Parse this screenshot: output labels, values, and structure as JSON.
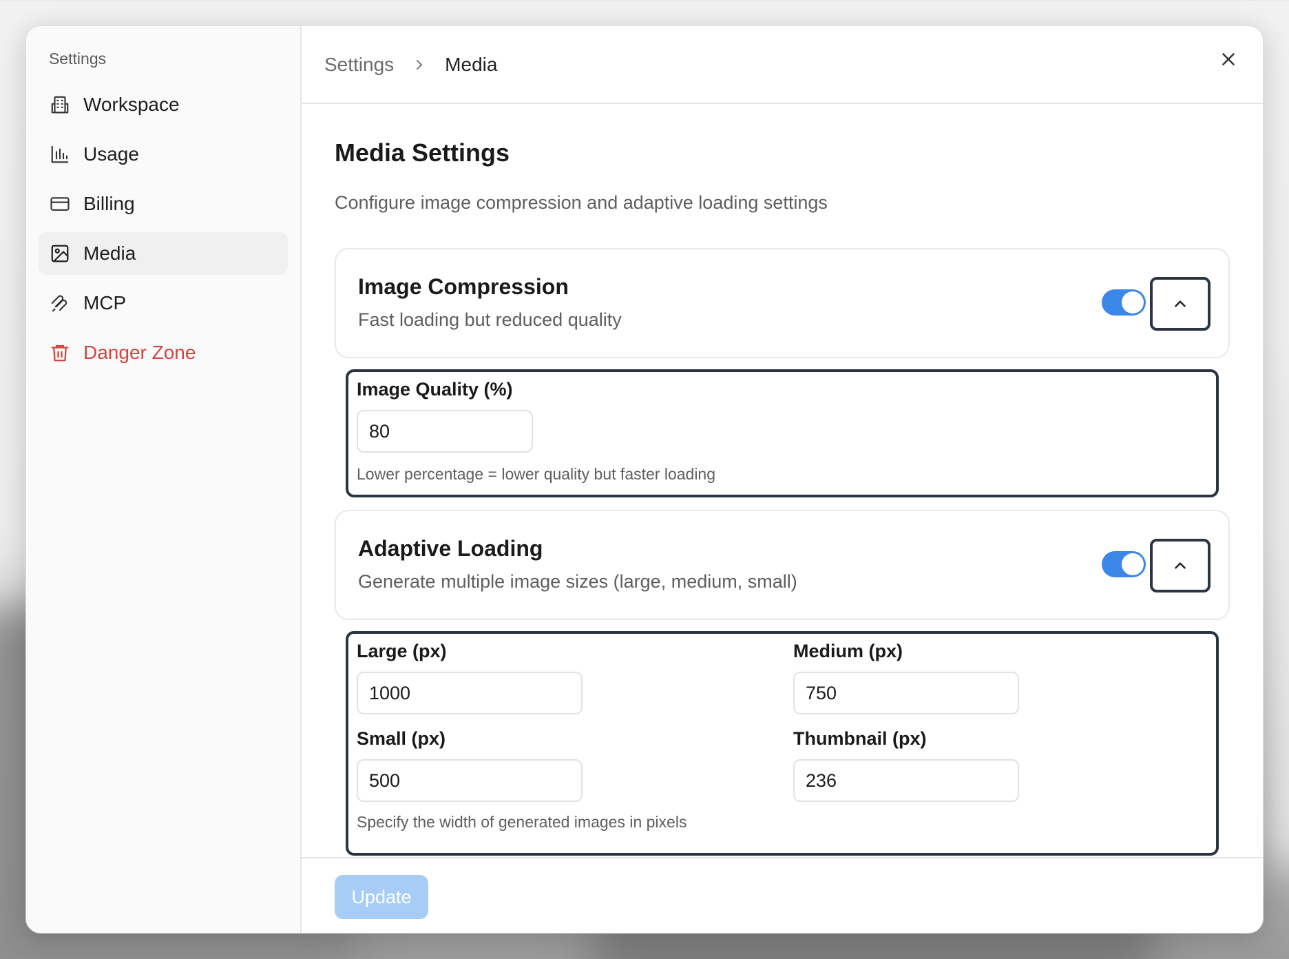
{
  "sidebar": {
    "heading": "Settings",
    "items": [
      {
        "label": "Workspace",
        "icon": "building-icon"
      },
      {
        "label": "Usage",
        "icon": "bar-chart-icon"
      },
      {
        "label": "Billing",
        "icon": "credit-card-icon"
      },
      {
        "label": "Media",
        "icon": "image-icon",
        "active": true
      },
      {
        "label": "MCP",
        "icon": "mcp-icon"
      },
      {
        "label": "Danger Zone",
        "icon": "trash-icon",
        "color": "#d2433f"
      }
    ]
  },
  "header": {
    "breadcrumb": [
      "Settings",
      "Media"
    ],
    "close_icon": "close-icon"
  },
  "main": {
    "title": "Media Settings",
    "description": "Configure image compression and adaptive loading settings",
    "compression": {
      "title": "Image Compression",
      "description": "Fast loading but reduced quality",
      "enabled": true,
      "quality_label": "Image Quality (%)",
      "quality_value": "80",
      "quality_hint": "Lower percentage = lower quality but faster loading"
    },
    "adaptive": {
      "title": "Adaptive Loading",
      "description": "Generate multiple image sizes (large, medium, small)",
      "enabled": true,
      "large_label": "Large (px)",
      "large_value": "1000",
      "medium_label": "Medium (px)",
      "medium_value": "750",
      "small_label": "Small (px)",
      "small_value": "500",
      "thumbnail_label": "Thumbnail (px)",
      "thumbnail_value": "236",
      "hint": "Specify the width of generated images in pixels"
    },
    "update_label": "Update"
  },
  "colors": {
    "accent": "#3b87e8",
    "danger": "#d2433f",
    "update_disabled": "#a7cdf6"
  }
}
